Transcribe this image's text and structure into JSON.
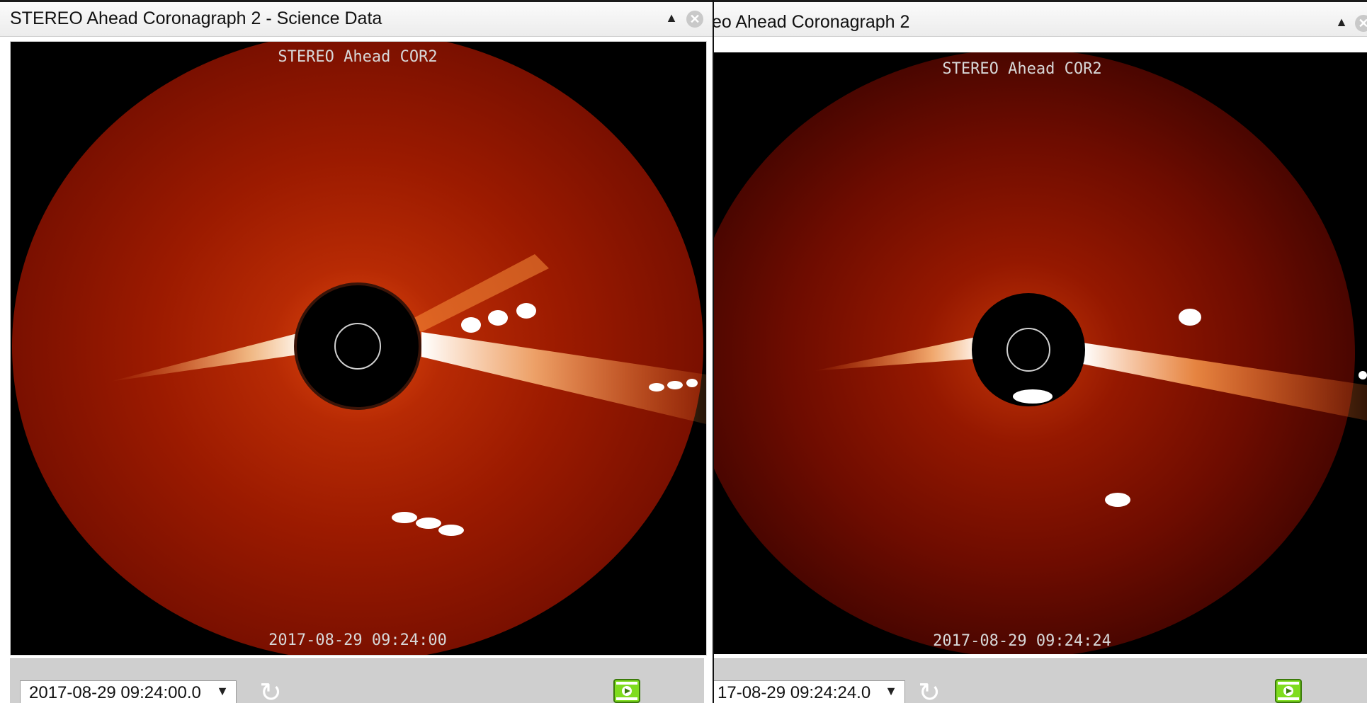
{
  "left_panel": {
    "title": "STEREO Ahead Coronagraph 2 - Science Data",
    "image_label": "STEREO Ahead COR2",
    "image_timestamp": "2017-08-29 09:24:00",
    "date_value": "2017-08-29 09:24:00.0",
    "collapse_glyph": "▲",
    "close_glyph": "✕",
    "select_arrow": "▼",
    "refresh_glyph": "↻"
  },
  "right_panel": {
    "title": "eo Ahead Coronagraph 2",
    "image_label": "STEREO Ahead COR2",
    "image_timestamp": "2017-08-29 09:24:24",
    "date_value": "17-08-29 09:24:24.0",
    "collapse_glyph": "▲",
    "close_glyph": "✕",
    "select_arrow": "▼",
    "refresh_glyph": "↻"
  },
  "icons": {
    "collapse": "collapse-arrow-icon",
    "close": "close-icon",
    "refresh": "refresh-icon",
    "movie": "movie-play-icon"
  },
  "colors": {
    "coronagraph_red": "#a81a00",
    "movie_green": "#7fdc1f"
  }
}
